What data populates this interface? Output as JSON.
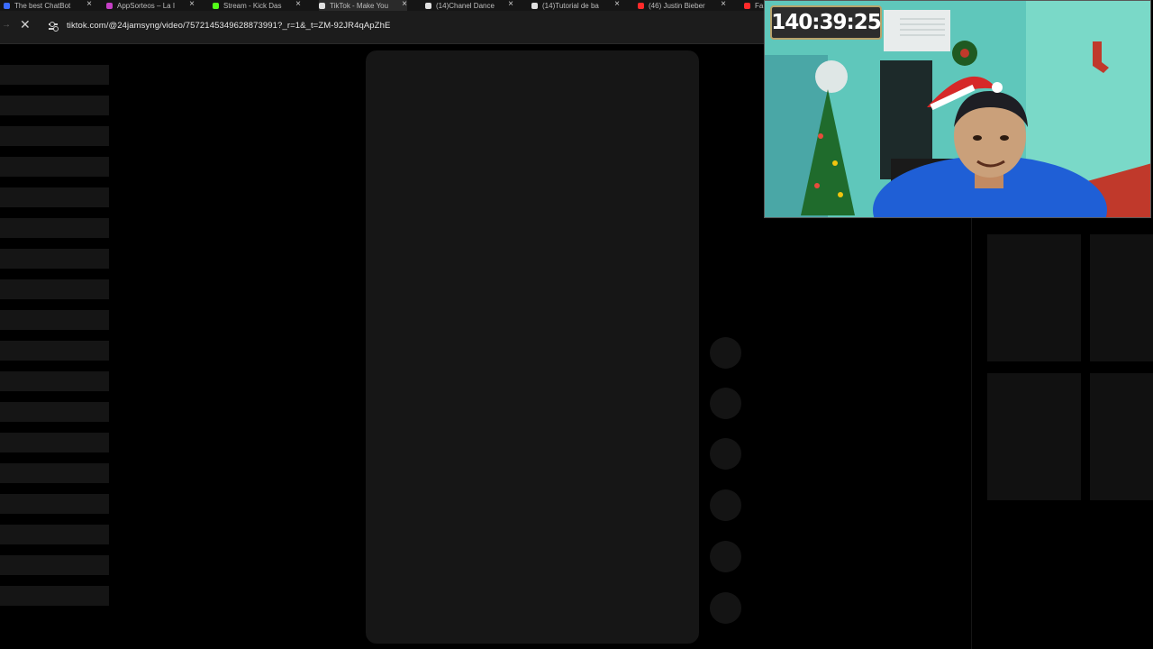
{
  "browser": {
    "tabs": [
      {
        "title": "The best ChatBot",
        "favicon_color": "#3b6cff",
        "active": false
      },
      {
        "title": "AppSorteos – La I",
        "favicon_color": "#c640c6",
        "active": false
      },
      {
        "title": "Stream - Kick Das",
        "favicon_color": "#53fc18",
        "active": false
      },
      {
        "title": "TikTok - Make You",
        "favicon_color": "#e0e0e0",
        "active": true
      },
      {
        "title": "(14)Chanel Dance",
        "favicon_color": "#e0e0e0",
        "active": false
      },
      {
        "title": "(14)Tutorial de ba",
        "favicon_color": "#e0e0e0",
        "active": false
      },
      {
        "title": "(46) Justin Bieber",
        "favicon_color": "#ff2a2a",
        "active": false
      },
      {
        "title": "Fa",
        "favicon_color": "#ff2a2a",
        "active": false
      }
    ],
    "close_glyph": "×",
    "address": {
      "url": "tiktok.com/@24jamsyng/video/7572145349628873991?_r=1&_t=ZM-92JR4qApZhE",
      "stop_glyph": "✕",
      "forward_glyph": "→"
    }
  },
  "webcam": {
    "timer": "140:39:25"
  },
  "icons": {
    "stop": "stop-loading-icon",
    "site_info": "site-info-icon",
    "close": "close-icon"
  }
}
